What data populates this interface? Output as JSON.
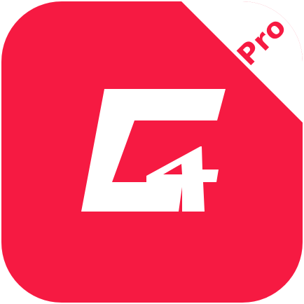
{
  "app_icon": {
    "badge_text": "Pro",
    "logo_name": "c4-logo",
    "colors": {
      "background": "#f61a42",
      "foreground": "#ffffff"
    }
  }
}
